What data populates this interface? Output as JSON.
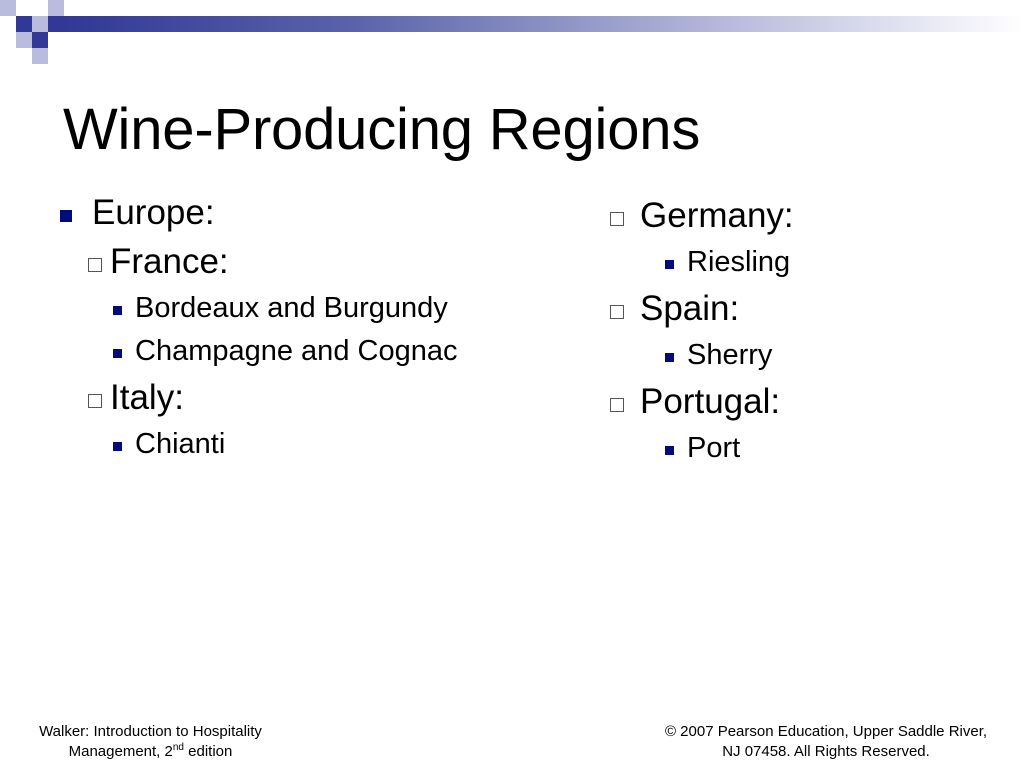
{
  "slide": {
    "title": "Wine-Producing Regions"
  },
  "left_column": {
    "region": "Europe:",
    "countries": [
      {
        "name": "France:",
        "items": [
          "Bordeaux and Burgundy",
          "Champagne and Cognac"
        ]
      },
      {
        "name": "Italy:",
        "items": [
          "Chianti"
        ]
      }
    ]
  },
  "right_column": {
    "countries": [
      {
        "name": "Germany:",
        "items": [
          "Riesling"
        ]
      },
      {
        "name": "Spain:",
        "items": [
          "Sherry"
        ]
      },
      {
        "name": "Portugal:",
        "items": [
          "Port"
        ]
      }
    ]
  },
  "footer": {
    "left_line1": "Walker: Introduction to Hospitality",
    "left_line2_prefix": "Management, 2",
    "left_line2_sup": "nd",
    "left_line2_suffix": " edition",
    "right_line1": "© 2007 Pearson Education, Upper Saddle River,",
    "right_line2": "NJ 07458. All Rights Reserved."
  },
  "colors": {
    "accent": "#313896",
    "bullet": "#000c7a",
    "decor_light": "#b9bcdc"
  }
}
